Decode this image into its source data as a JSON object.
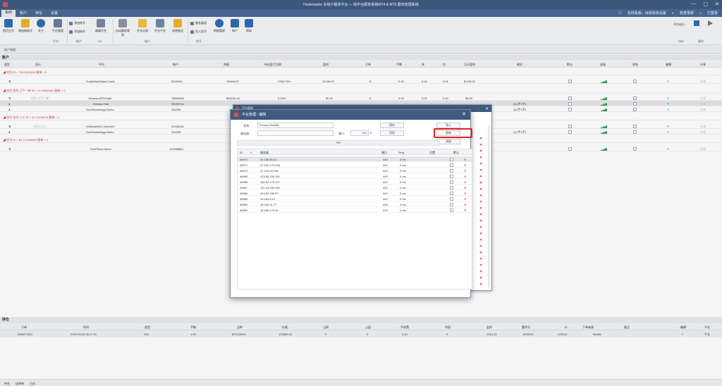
{
  "window": {
    "title": "Hookmaster 多账户跟单平台 — 跨平台跟单系统MT4 & MT5 跟单管理系统",
    "minimize": "—",
    "maximize": "▢",
    "close": "✕"
  },
  "menu": {
    "tabs": [
      "系统",
      "帐户",
      "持仓",
      "设置"
    ],
    "right_notice": "在线看板，目前状态设置",
    "right_update": "检查更新",
    "right_login": "已登录"
  },
  "ribbon": {
    "buttons": [
      {
        "label": "首页主页"
      },
      {
        "label": "增加新帐号"
      },
      {
        "label": "关于"
      },
      {
        "label": "平台管理"
      },
      {
        "label": "编辑开仓"
      },
      {
        "label": "自动跟踪规则"
      },
      {
        "label": "开仓记录"
      },
      {
        "label": "开仓平仓"
      },
      {
        "label": "消息推送"
      },
      {
        "label": "网络管理"
      },
      {
        "label": "帐户"
      },
      {
        "label": "帮助"
      }
    ],
    "small_buttons": [
      {
        "label": "添加帐号"
      },
      {
        "label": "添加帐号"
      },
      {
        "label": "服务器组"
      },
      {
        "label": "导入信号"
      }
    ],
    "groups": [
      "平台",
      "帐户",
      "EA",
      "帐户",
      "持仓",
      "信号",
      "操作"
    ],
    "right_labels": [
      "平台运行",
      "启动",
      "停止"
    ]
  },
  "view_label": "帐户视图",
  "accounts": {
    "section_title": "账户",
    "columns": [
      "类型",
      "显示",
      "平台",
      "帐户",
      "净值",
      "持仓盈亏比例",
      "盈利",
      "订单",
      "手数",
      "多",
      "空",
      "当天盈利",
      "模式",
      "默认",
      "连接",
      "状态",
      "编辑",
      "分享"
    ],
    "groups": [
      {
        "label": "◢ 信号  ID = 705 5232694  跟单 = 0"
      },
      {
        "label": "◢ 信号  信号-订下一单  ID = 14 76663482  跟单 = 2"
      },
      {
        "label": "◢ 信号  信号-人工  ID = 31 31236116  跟单 = 1"
      },
      {
        "label": "◢ 信号  ID = 82 112496854  跟单 = 0"
      }
    ],
    "rows": [
      {
        "name": "",
        "platform": "TradeMaxGlobal-Live5",
        "account": "5232694",
        "equity": "$1945.87",
        "ratio": "4766.79%",
        "profit": "$-108.02",
        "orders": "6",
        "lots": "0.15",
        "buy": "0.24",
        "sell": "0.01",
        "today": "$-108.02",
        "mode": "",
        "share": "分享"
      },
      {
        "name": "信号-订下一单",
        "platform": "Exness-MT5Trial5",
        "account": "76663482",
        "equity": "$95228.16",
        "ratio": "0.00%",
        "profit": "$0.00",
        "orders": "0",
        "lots": "0.00",
        "buy": "0.00",
        "sell": "0.00",
        "today": "$0.00",
        "mode": "",
        "share": "分享"
      },
      {
        "name": "",
        "platform": "Exness-Trial",
        "account": "95099744",
        "equity": "",
        "ratio": "",
        "profit": "",
        "orders": "",
        "lots": "",
        "buy": "",
        "sell": "",
        "today": "",
        "mode": "以1手1手1",
        "share": "分享"
      },
      {
        "name": "",
        "platform": "DooTechnology-Demo",
        "account": "242325",
        "equity": "",
        "ratio": "",
        "profit": "",
        "orders": "",
        "lots": "",
        "buy": "",
        "sell": "",
        "today": "",
        "mode": "以1手1手1",
        "share": "分享"
      },
      {
        "name": "信号-人工",
        "platform": "ICMarketsSC-Demo03",
        "account": "31236116",
        "equity": "",
        "ratio": "",
        "profit": "",
        "orders": "",
        "lots": "",
        "buy": "",
        "sell": "",
        "today": "",
        "mode": "",
        "share": "分享"
      },
      {
        "name": "",
        "platform": "DooTechnology-Demo",
        "account": "242325",
        "equity": "",
        "ratio": "",
        "profit": "",
        "orders": "",
        "lots": "",
        "buy": "",
        "sell": "",
        "today": "",
        "mode": "以1手1手1",
        "share": "分享"
      },
      {
        "name": "",
        "platform": "DooPrime-Demo",
        "account": "112496854",
        "equity": "",
        "ratio": "",
        "profit": "",
        "orders": "",
        "lots": "",
        "buy": "",
        "sell": "",
        "today": "",
        "mode": "",
        "share": "分享"
      }
    ]
  },
  "orders": {
    "section_title": "持仓",
    "columns": [
      "订单",
      "时间",
      "类型",
      "手数",
      "品种",
      "价格",
      "止损",
      "止盈",
      "手续费",
      "利息",
      "盈利",
      "魔术号",
      "价",
      "下单来源",
      "备注",
      "编辑",
      "平仓"
    ],
    "row": {
      "order": "1368472612",
      "time": "2025-06-06 05:17:41",
      "type": "Sell",
      "lots": "1.00",
      "symbol": "BTCUSDm",
      "price": "102880.64",
      "sl": "0",
      "tp": "0",
      "commission": "0.00",
      "swap": "0",
      "profit": "-2261.41",
      "magic": "1000014",
      "pips": "-226141",
      "source": "Mobile",
      "comment": "",
      "close": "平仓"
    }
  },
  "status_bar": [
    "持仓",
    "挂单单",
    "日志"
  ],
  "dialog_back": {
    "title": "平台管理"
  },
  "dialog": {
    "title": "平台管理 - 编辑",
    "close": "✕",
    "name_label": "名称:",
    "name_value": "Exness-Real36",
    "server_label": "服务器:",
    "server_value": "",
    "port_label": "端口:",
    "port_value": "443",
    "save_button": "保存",
    "add_button": "添加",
    "import_button": "导入",
    "update_button": "更新",
    "test_button": "测速",
    "progress_text": "0%",
    "progress_value": 0,
    "columns": [
      "ID",
      "服务器",
      "端口",
      "Ping",
      "位置",
      "默认"
    ],
    "servers": [
      {
        "id": "46972",
        "ip": "54.180.65.21",
        "port": "443",
        "ping": "0 ms"
      },
      {
        "id": "46971",
        "ip": "47.100.170.245",
        "port": "443",
        "ping": "0 ms"
      },
      {
        "id": "46970",
        "ip": "47.100.219.58",
        "port": "443",
        "ping": "0 ms"
      },
      {
        "id": "46969",
        "ip": "123.56.155.115",
        "port": "443",
        "ping": "0 ms"
      },
      {
        "id": "46968",
        "ip": "182.92.178.197",
        "port": "443",
        "ping": "0 ms"
      },
      {
        "id": "46967",
        "ip": "121.43.230.250",
        "port": "443",
        "ping": "0 ms"
      },
      {
        "id": "46966",
        "ip": "18.162.180.97",
        "port": "443",
        "ping": "0 ms"
      },
      {
        "id": "46965",
        "ip": "18.163.8.14",
        "port": "443",
        "ping": "0 ms"
      },
      {
        "id": "46964",
        "ip": "18.166.41.77",
        "port": "443",
        "ping": "0 ms"
      },
      {
        "id": "46963",
        "ip": "18.166.175.46",
        "port": "443",
        "ping": "0 ms"
      }
    ]
  },
  "colors": {
    "titlebar": "#3f5b80",
    "danger": "#d9343a",
    "highlight": "#e0201c",
    "signal": "#3aa050",
    "edit": "#2a6bd6"
  }
}
